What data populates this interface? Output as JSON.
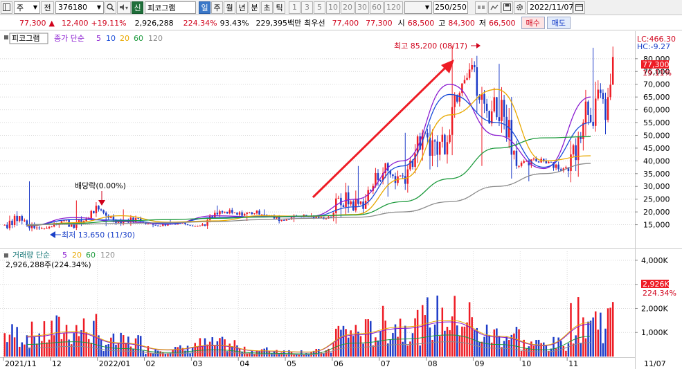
{
  "toolbar": {
    "market": "주",
    "market_btn": "전",
    "code": "376180",
    "badge": "신",
    "name": "피코그램",
    "periods": [
      "일",
      "주",
      "월",
      "년",
      "분",
      "초",
      "틱"
    ],
    "nums": [
      "1",
      "3",
      "5",
      "10",
      "20",
      "30",
      "60",
      "120"
    ],
    "count": "250/250",
    "date": "2022/11/07",
    "icons": [
      "panel-icon",
      "dropdown-icon",
      "search-icon",
      "speaker-icon",
      "gear-icon"
    ]
  },
  "quote": {
    "price": "77,300",
    "change": "12,400",
    "rate": "+19.11%",
    "volume": "2,926,288",
    "vol_ratio": "224.34%",
    "pct": "93.43%",
    "amount": "229,395백만",
    "best_label": "최우선",
    "ask": "77,400",
    "bid": "77,300",
    "open_label": "시",
    "open": "68,500",
    "high_label": "고",
    "high": "84,300",
    "low_label": "저",
    "low": "66,500",
    "buy": "매수",
    "sell": "매도"
  },
  "legend": {
    "name": "피코그램",
    "series": "종가 단순",
    "n5": "5",
    "n10": "10",
    "n20": "20",
    "n60": "60",
    "n120": "120",
    "vol_series": "거래량 단순",
    "vol_readout": "2,926,288주(224.34%)"
  },
  "annotations": {
    "high": "최고 85,200 (08/17)",
    "low": "최저 13,650 (11/30)",
    "dividend": "배당락(0.00%)"
  },
  "price_axis": {
    "lc": "LC:466.30",
    "hc": "HC:-9.27",
    "ticks": [
      "80,000",
      "75,000",
      "70,000",
      "65,000",
      "60,000",
      "55,000",
      "50,000",
      "45,000",
      "40,000",
      "35,000",
      "30,000",
      "25,000",
      "20,000",
      "15,000"
    ],
    "last": "77,300",
    "last_pct": "19.11%"
  },
  "vol_axis": {
    "ticks": [
      "4,000K",
      "3,000K",
      "2,000K",
      "1,000K"
    ],
    "last": "2,926K",
    "last_pct": "224.34%"
  },
  "months": [
    "2021/11",
    "12",
    "2022/01",
    "02",
    "03",
    "04",
    "05",
    "06",
    "07",
    "08",
    "09",
    "10",
    "11",
    "11/07"
  ],
  "colors": {
    "up": "#ee1c25",
    "down": "#1e3cc8",
    "ma5": "#8a1bd0",
    "ma10": "#1a4cd8",
    "ma20": "#e8a800",
    "ma60": "#1c9a3c",
    "ma120": "#8c8c8c"
  },
  "chart_data": {
    "type": "candlestick",
    "title": "",
    "y_range": [
      10000,
      87000
    ],
    "volume_range": [
      0,
      4200
    ],
    "volume_unit": "K",
    "months": [
      {
        "label": "2021/11",
        "open": 15000,
        "close": 13800,
        "high": 32000,
        "low": 13650,
        "avg_volume": 900
      },
      {
        "label": "12",
        "open": 14000,
        "close": 19500,
        "high": 24500,
        "low": 13800,
        "avg_volume": 1100
      },
      {
        "label": "2022/01",
        "open": 19500,
        "close": 15500,
        "high": 21000,
        "low": 14500,
        "avg_volume": 600
      },
      {
        "label": "02",
        "open": 15500,
        "close": 15000,
        "high": 17000,
        "low": 14000,
        "avg_volume": 300
      },
      {
        "label": "03",
        "open": 15000,
        "close": 20000,
        "high": 22500,
        "low": 14500,
        "avg_volume": 500
      },
      {
        "label": "04",
        "open": 20000,
        "close": 17500,
        "high": 21000,
        "low": 16500,
        "avg_volume": 250
      },
      {
        "label": "05",
        "open": 17500,
        "close": 18500,
        "high": 19500,
        "low": 16000,
        "avg_volume": 200
      },
      {
        "label": "06",
        "open": 18500,
        "close": 32000,
        "high": 38000,
        "low": 18000,
        "avg_volume": 1000
      },
      {
        "label": "07",
        "open": 32000,
        "close": 45000,
        "high": 51000,
        "low": 26000,
        "avg_volume": 1300
      },
      {
        "label": "08",
        "open": 45000,
        "close": 75000,
        "high": 85200,
        "low": 42000,
        "avg_volume": 1600
      },
      {
        "label": "09",
        "open": 75000,
        "close": 40000,
        "high": 78000,
        "low": 38000,
        "avg_volume": 900
      },
      {
        "label": "10",
        "open": 40000,
        "close": 38000,
        "high": 41000,
        "low": 32000,
        "avg_volume": 500
      },
      {
        "label": "11",
        "open": 38000,
        "close": 77300,
        "high": 84300,
        "low": 36000,
        "avg_volume": 1500
      }
    ],
    "series": [
      {
        "name": "5",
        "values": [
          14500,
          17800,
          16200,
          15200,
          18500,
          18000,
          18200,
          25000,
          40000,
          70000,
          50000,
          37000,
          65000
        ]
      },
      {
        "name": "10",
        "values": [
          14600,
          17000,
          16800,
          15400,
          17800,
          18200,
          18100,
          22000,
          38000,
          66000,
          55000,
          37500,
          55000
        ]
      },
      {
        "name": "20",
        "values": [
          14800,
          15800,
          18500,
          16000,
          16500,
          18500,
          18300,
          19000,
          33000,
          58000,
          68000,
          40000,
          42000
        ]
      },
      {
        "name": "60",
        "values": [
          15000,
          15500,
          16500,
          17000,
          17500,
          18000,
          18400,
          18800,
          24000,
          33000,
          45000,
          49000,
          49500
        ]
      },
      {
        "name": "120",
        "values": [
          15000,
          15200,
          15500,
          15800,
          16200,
          17000,
          17500,
          17900,
          20000,
          24000,
          30000,
          35000,
          39000
        ]
      }
    ]
  }
}
